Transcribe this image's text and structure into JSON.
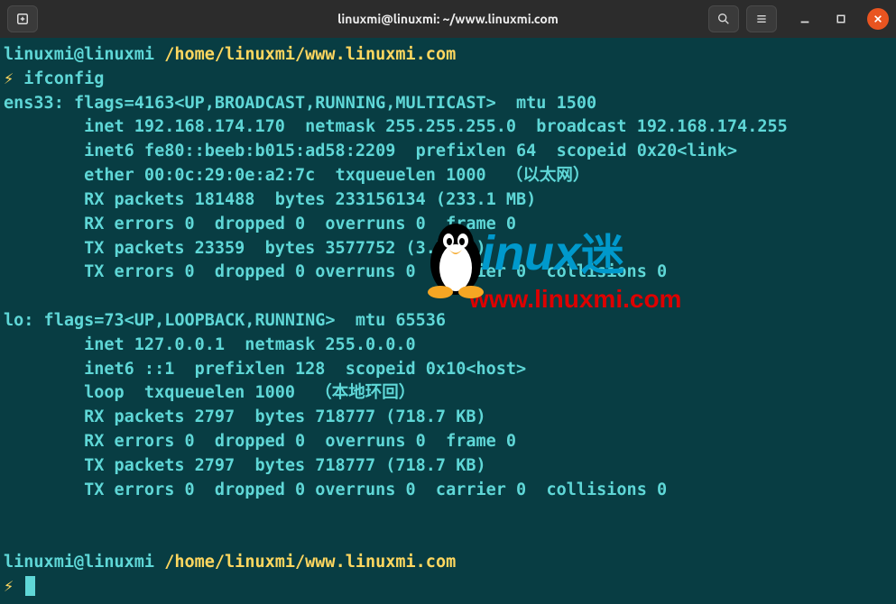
{
  "window": {
    "title": "linuxmi@linuxmi: ~/www.linuxmi.com"
  },
  "prompt": {
    "user_host": "linuxmi@linuxmi",
    "path": "/home/linuxmi/www.linuxmi.com",
    "bolt": "⚡",
    "command": "ifconfig"
  },
  "output": {
    "ens33": {
      "header": "ens33: flags=4163<UP,BROADCAST,RUNNING,MULTICAST>  mtu 1500",
      "inet": "        inet 192.168.174.170  netmask 255.255.255.0  broadcast 192.168.174.255",
      "inet6": "        inet6 fe80::beeb:b015:ad58:2209  prefixlen 64  scopeid 0x20<link>",
      "ether": "        ether 00:0c:29:0e:a2:7c  txqueuelen 1000  （以太网）",
      "rx_packets": "        RX packets 181488  bytes 233156134 (233.1 MB)",
      "rx_errors": "        RX errors 0  dropped 0  overruns 0  frame 0",
      "tx_packets": "        TX packets 23359  bytes 3577752 (3.5 MB)",
      "tx_errors": "        TX errors 0  dropped 0 overruns 0  carrier 0  collisions 0"
    },
    "lo": {
      "header": "lo: flags=73<UP,LOOPBACK,RUNNING>  mtu 65536",
      "inet": "        inet 127.0.0.1  netmask 255.0.0.0",
      "inet6": "        inet6 ::1  prefixlen 128  scopeid 0x10<host>",
      "loop": "        loop  txqueuelen 1000  （本地环回）",
      "rx_packets": "        RX packets 2797  bytes 718777 (718.7 KB)",
      "rx_errors": "        RX errors 0  dropped 0  overruns 0  frame 0",
      "tx_packets": "        TX packets 2797  bytes 718777 (718.7 KB)",
      "tx_errors": "        TX errors 0  dropped 0 overruns 0  carrier 0  collisions 0"
    }
  },
  "watermark": {
    "brand": "Linux",
    "cn": "迷",
    "url": "www.linuxmi.com"
  }
}
